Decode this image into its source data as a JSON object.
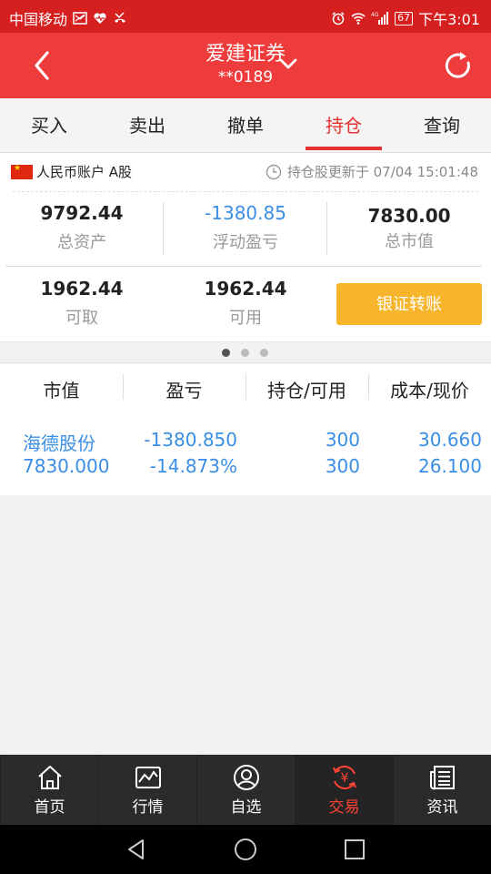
{
  "status_bar": {
    "carrier": "中国移动",
    "time": "下午3:01",
    "battery": "67"
  },
  "header": {
    "title": "爱建证券",
    "account_masked": "**0189"
  },
  "tabs": [
    {
      "label": "买入"
    },
    {
      "label": "卖出"
    },
    {
      "label": "撤单"
    },
    {
      "label": "持仓",
      "active": true
    },
    {
      "label": "查询"
    }
  ],
  "account": {
    "name": "人民币账户 A股",
    "update_text": "持仓股更新于 07/04 15:01:48"
  },
  "summary": {
    "total_assets": {
      "value": "9792.44",
      "label": "总资产"
    },
    "floating_pl": {
      "value": "-1380.85",
      "label": "浮动盈亏"
    },
    "market_value": {
      "value": "7830.00",
      "label": "总市值"
    },
    "withdrawable": {
      "value": "1962.44",
      "label": "可取"
    },
    "available": {
      "value": "1962.44",
      "label": "可用"
    },
    "transfer_label": "银证转账"
  },
  "pager": {
    "count": 3,
    "current": 1
  },
  "table": {
    "headers": [
      "市值",
      "盈亏",
      "持仓/可用",
      "成本/现价"
    ],
    "rows": [
      {
        "name": "海德股份",
        "market_value": "7830.000",
        "pl": "-1380.850",
        "pl_pct": "-14.873%",
        "position": "300",
        "available": "300",
        "cost": "30.660",
        "price": "26.100"
      }
    ]
  },
  "bottom_nav": [
    {
      "label": "首页",
      "icon": "home-icon"
    },
    {
      "label": "行情",
      "icon": "market-chart-icon"
    },
    {
      "label": "自选",
      "icon": "user-circle-icon"
    },
    {
      "label": "交易",
      "icon": "yuan-exchange-icon",
      "active": true
    },
    {
      "label": "资讯",
      "icon": "news-icon"
    }
  ],
  "colors": {
    "header_red": "#ee3b3b",
    "status_red": "#d5201f",
    "accent_red": "#e53131",
    "blue": "#3a8ee6",
    "button_yellow": "#f7b52b"
  }
}
